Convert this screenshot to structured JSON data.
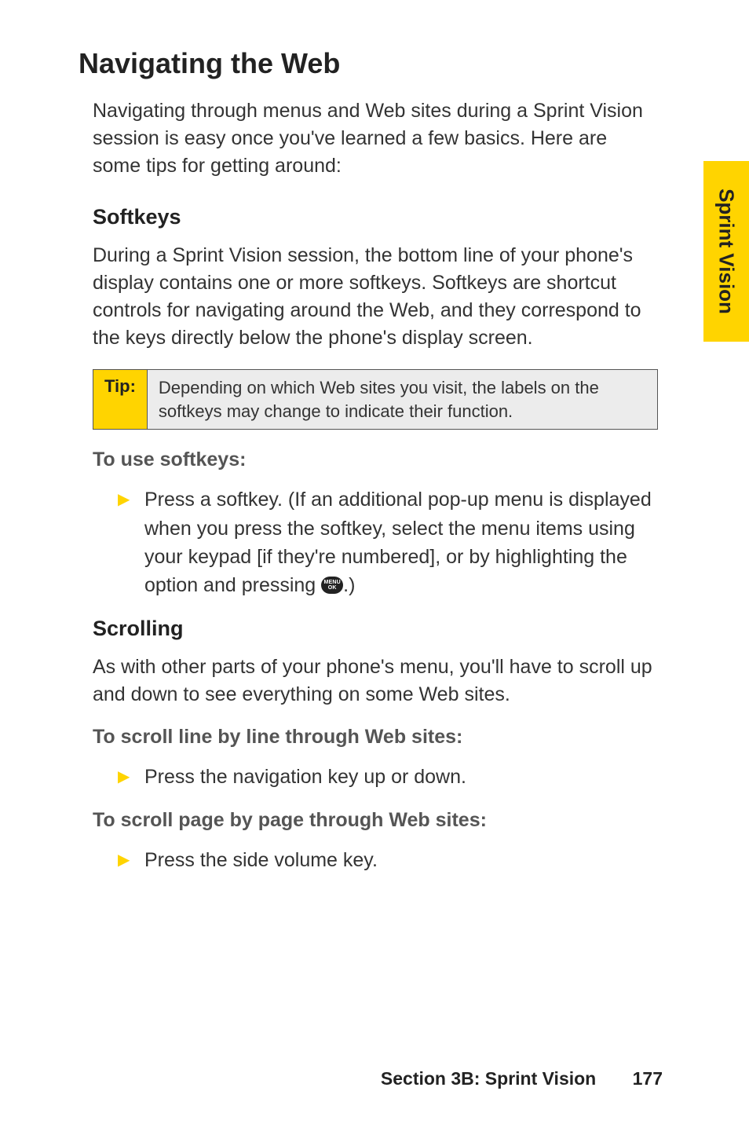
{
  "sideTab": "Sprint Vision",
  "h1": "Navigating the Web",
  "intro": "Navigating through menus and Web sites during a Sprint Vision session is easy once you've learned a few basics. Here are some tips for getting around:",
  "softkeys": {
    "heading": "Softkeys",
    "para": "During a Sprint Vision session, the bottom line of your phone's display contains one or more softkeys. Softkeys are shortcut controls for navigating around the Web, and they correspond to the keys directly below the phone's display screen."
  },
  "tip": {
    "label": "Tip:",
    "body": "Depending on which Web sites you visit, the labels on the softkeys may change to indicate their function."
  },
  "useSoftkeys": {
    "subhead": "To use softkeys:",
    "bullet_pre": "Press a softkey. (If an additional pop-up menu is displayed when you press the softkey, select the menu items using your keypad [if they're numbered], or by highlighting the option and pressing ",
    "bullet_post": ".)",
    "menuTop": "MENU",
    "menuBottom": "OK"
  },
  "scrolling": {
    "heading": "Scrolling",
    "para": "As with other parts of your phone's menu, you'll have to scroll up and down to see everything on some Web sites.",
    "sub1": "To scroll line by line through Web sites:",
    "bullet1": "Press the navigation key up or down.",
    "sub2": "To scroll page by page through Web sites:",
    "bullet2": "Press the side volume key."
  },
  "footer": {
    "section": "Section 3B: Sprint Vision",
    "page": "177"
  }
}
